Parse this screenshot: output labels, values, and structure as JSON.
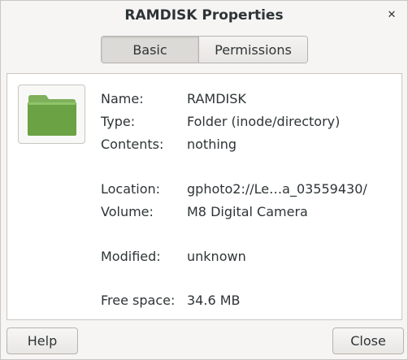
{
  "window": {
    "title": "RAMDISK Properties",
    "close_glyph": "✕"
  },
  "tabs": [
    {
      "label": "Basic",
      "selected": true
    },
    {
      "label": "Permissions",
      "selected": false
    }
  ],
  "icon": {
    "name": "folder-icon",
    "color": "#6aa244"
  },
  "properties": {
    "name": {
      "label": "Name:",
      "value": "RAMDISK"
    },
    "type": {
      "label": "Type:",
      "value": "Folder (inode/directory)"
    },
    "contents": {
      "label": "Contents:",
      "value": "nothing"
    },
    "location": {
      "label": "Location:",
      "value": "gphoto2://Le…a_03559430/"
    },
    "volume": {
      "label": "Volume:",
      "value": "M8 Digital Camera"
    },
    "modified": {
      "label": "Modified:",
      "value": "unknown"
    },
    "free_space": {
      "label": "Free space:",
      "value": "34.6 MB"
    }
  },
  "footer": {
    "help_label": "Help",
    "close_label": "Close"
  }
}
